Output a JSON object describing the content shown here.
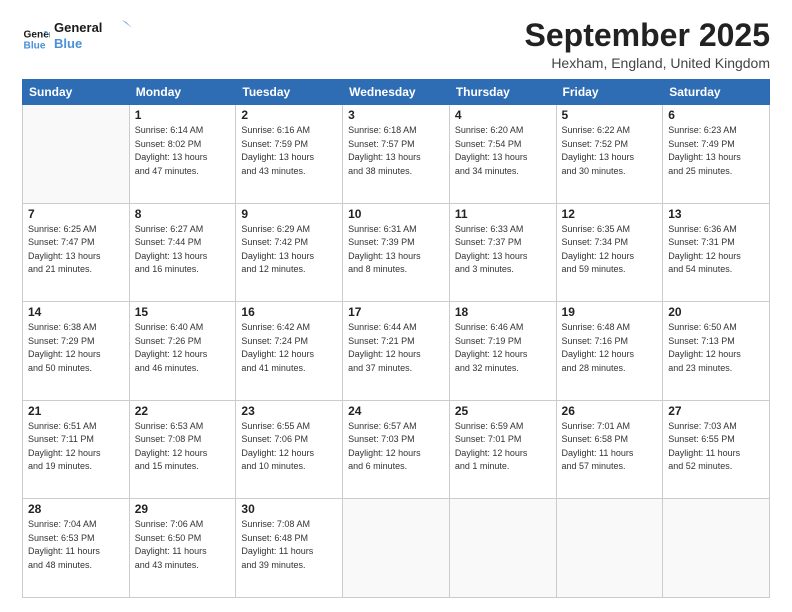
{
  "logo": {
    "line1": "General",
    "line2": "Blue"
  },
  "title": "September 2025",
  "location": "Hexham, England, United Kingdom",
  "days_of_week": [
    "Sunday",
    "Monday",
    "Tuesday",
    "Wednesday",
    "Thursday",
    "Friday",
    "Saturday"
  ],
  "weeks": [
    [
      {
        "day": "",
        "info": ""
      },
      {
        "day": "1",
        "info": "Sunrise: 6:14 AM\nSunset: 8:02 PM\nDaylight: 13 hours\nand 47 minutes."
      },
      {
        "day": "2",
        "info": "Sunrise: 6:16 AM\nSunset: 7:59 PM\nDaylight: 13 hours\nand 43 minutes."
      },
      {
        "day": "3",
        "info": "Sunrise: 6:18 AM\nSunset: 7:57 PM\nDaylight: 13 hours\nand 38 minutes."
      },
      {
        "day": "4",
        "info": "Sunrise: 6:20 AM\nSunset: 7:54 PM\nDaylight: 13 hours\nand 34 minutes."
      },
      {
        "day": "5",
        "info": "Sunrise: 6:22 AM\nSunset: 7:52 PM\nDaylight: 13 hours\nand 30 minutes."
      },
      {
        "day": "6",
        "info": "Sunrise: 6:23 AM\nSunset: 7:49 PM\nDaylight: 13 hours\nand 25 minutes."
      }
    ],
    [
      {
        "day": "7",
        "info": "Sunrise: 6:25 AM\nSunset: 7:47 PM\nDaylight: 13 hours\nand 21 minutes."
      },
      {
        "day": "8",
        "info": "Sunrise: 6:27 AM\nSunset: 7:44 PM\nDaylight: 13 hours\nand 16 minutes."
      },
      {
        "day": "9",
        "info": "Sunrise: 6:29 AM\nSunset: 7:42 PM\nDaylight: 13 hours\nand 12 minutes."
      },
      {
        "day": "10",
        "info": "Sunrise: 6:31 AM\nSunset: 7:39 PM\nDaylight: 13 hours\nand 8 minutes."
      },
      {
        "day": "11",
        "info": "Sunrise: 6:33 AM\nSunset: 7:37 PM\nDaylight: 13 hours\nand 3 minutes."
      },
      {
        "day": "12",
        "info": "Sunrise: 6:35 AM\nSunset: 7:34 PM\nDaylight: 12 hours\nand 59 minutes."
      },
      {
        "day": "13",
        "info": "Sunrise: 6:36 AM\nSunset: 7:31 PM\nDaylight: 12 hours\nand 54 minutes."
      }
    ],
    [
      {
        "day": "14",
        "info": "Sunrise: 6:38 AM\nSunset: 7:29 PM\nDaylight: 12 hours\nand 50 minutes."
      },
      {
        "day": "15",
        "info": "Sunrise: 6:40 AM\nSunset: 7:26 PM\nDaylight: 12 hours\nand 46 minutes."
      },
      {
        "day": "16",
        "info": "Sunrise: 6:42 AM\nSunset: 7:24 PM\nDaylight: 12 hours\nand 41 minutes."
      },
      {
        "day": "17",
        "info": "Sunrise: 6:44 AM\nSunset: 7:21 PM\nDaylight: 12 hours\nand 37 minutes."
      },
      {
        "day": "18",
        "info": "Sunrise: 6:46 AM\nSunset: 7:19 PM\nDaylight: 12 hours\nand 32 minutes."
      },
      {
        "day": "19",
        "info": "Sunrise: 6:48 AM\nSunset: 7:16 PM\nDaylight: 12 hours\nand 28 minutes."
      },
      {
        "day": "20",
        "info": "Sunrise: 6:50 AM\nSunset: 7:13 PM\nDaylight: 12 hours\nand 23 minutes."
      }
    ],
    [
      {
        "day": "21",
        "info": "Sunrise: 6:51 AM\nSunset: 7:11 PM\nDaylight: 12 hours\nand 19 minutes."
      },
      {
        "day": "22",
        "info": "Sunrise: 6:53 AM\nSunset: 7:08 PM\nDaylight: 12 hours\nand 15 minutes."
      },
      {
        "day": "23",
        "info": "Sunrise: 6:55 AM\nSunset: 7:06 PM\nDaylight: 12 hours\nand 10 minutes."
      },
      {
        "day": "24",
        "info": "Sunrise: 6:57 AM\nSunset: 7:03 PM\nDaylight: 12 hours\nand 6 minutes."
      },
      {
        "day": "25",
        "info": "Sunrise: 6:59 AM\nSunset: 7:01 PM\nDaylight: 12 hours\nand 1 minute."
      },
      {
        "day": "26",
        "info": "Sunrise: 7:01 AM\nSunset: 6:58 PM\nDaylight: 11 hours\nand 57 minutes."
      },
      {
        "day": "27",
        "info": "Sunrise: 7:03 AM\nSunset: 6:55 PM\nDaylight: 11 hours\nand 52 minutes."
      }
    ],
    [
      {
        "day": "28",
        "info": "Sunrise: 7:04 AM\nSunset: 6:53 PM\nDaylight: 11 hours\nand 48 minutes."
      },
      {
        "day": "29",
        "info": "Sunrise: 7:06 AM\nSunset: 6:50 PM\nDaylight: 11 hours\nand 43 minutes."
      },
      {
        "day": "30",
        "info": "Sunrise: 7:08 AM\nSunset: 6:48 PM\nDaylight: 11 hours\nand 39 minutes."
      },
      {
        "day": "",
        "info": ""
      },
      {
        "day": "",
        "info": ""
      },
      {
        "day": "",
        "info": ""
      },
      {
        "day": "",
        "info": ""
      }
    ]
  ]
}
